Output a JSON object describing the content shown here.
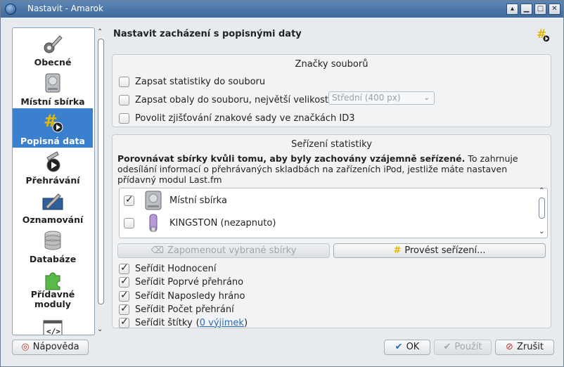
{
  "window": {
    "title": "Nastavit - Amarok",
    "controls": [
      "▴",
      "▁",
      "□",
      "✕"
    ]
  },
  "sidebar": {
    "items": [
      {
        "label": "Obecné",
        "icon": "wrench-gear-icon"
      },
      {
        "label": "Místní sbírka",
        "icon": "hard-drive-icon"
      },
      {
        "label": "Popisná data",
        "icon": "tag-play-icon"
      },
      {
        "label": "Přehrávání",
        "icon": "wrench-play-icon"
      },
      {
        "label": "Oznamování",
        "icon": "notification-wrench-icon"
      },
      {
        "label": "Databáze",
        "icon": "database-icon"
      },
      {
        "label": "Přídavné moduly",
        "icon": "puzzle-icon"
      },
      {
        "label": "",
        "icon": "script-icon"
      }
    ],
    "selected": "Popisná data"
  },
  "main": {
    "title": "Nastavit zacházení s popisnými daty"
  },
  "file_tags": {
    "title": "Značky souborů",
    "options": [
      {
        "label": "Zapsat statistiky do souboru",
        "checked": false
      },
      {
        "label": "Zapsat obaly do souboru, největší velikost:",
        "checked": false
      },
      {
        "label": "Povolit zjišťování znakové sady ve značkách ID3",
        "checked": false
      }
    ],
    "cover_size_value": "Střední (400 px)"
  },
  "sync": {
    "title": "Seřízení statistiky",
    "description_bold": "Porovnávat sbírky kvůli tomu, aby byly zachovány vzájemně seřízené.",
    "description_rest": " To zahrnuje odesílání informací o přehrávaných skladbách na zařízeních iPod, jestliže máte nastaven přídavný modul Last.fm",
    "collections": [
      {
        "label": "Místní sbírka",
        "checked": true,
        "icon": "hard-drive-icon"
      },
      {
        "label": "KINGSTON (nezapnuto)",
        "checked": false,
        "icon": "usb-stick-icon"
      }
    ],
    "forget_button": "Zapomenout vybrané sbírky",
    "sync_button": "Provést seřízení...",
    "options": [
      {
        "label": "Seřídit Hodnocení",
        "checked": true
      },
      {
        "label": "Seřídit Poprvé přehráno",
        "checked": true
      },
      {
        "label": "Seřídit Naposledy hráno",
        "checked": true
      },
      {
        "label": "Seřídit Počet přehrání",
        "checked": true
      },
      {
        "label": "Seřídit štítky",
        "checked": true
      }
    ],
    "exceptions_link": "0 výjimek"
  },
  "footer": {
    "help": "Nápověda",
    "ok": "OK",
    "apply": "Použít",
    "cancel": "Zrušit"
  },
  "colors": {
    "selection": "#3b7fcf",
    "titlebar": "#4a77ab",
    "link": "#2a6bc0"
  }
}
